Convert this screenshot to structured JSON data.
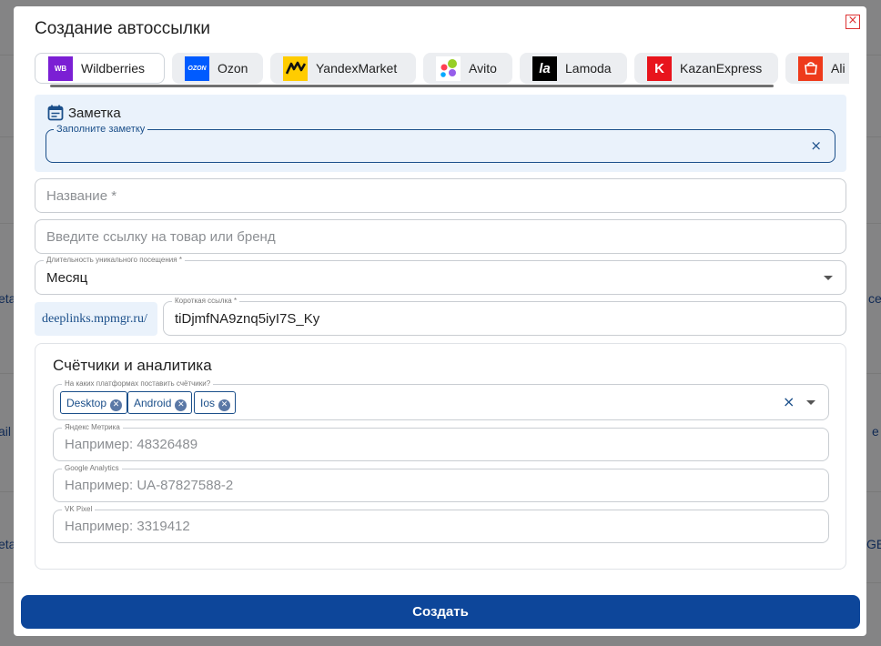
{
  "modal": {
    "title": "Создание автоссылки",
    "close_symbol": "×",
    "tabs": [
      {
        "label": "Wildberries",
        "logo": "WB",
        "logo_bg": "#7b1fd4",
        "active": true
      },
      {
        "label": "Ozon",
        "logo": "OZON",
        "logo_bg": "#005bff",
        "active": false
      },
      {
        "label": "YandexMarket",
        "logo": "YM",
        "logo_bg": "#ffcc00",
        "active": false
      },
      {
        "label": "Avito",
        "logo": "avito-dots",
        "logo_bg": "#ffffff",
        "active": false
      },
      {
        "label": "Lamoda",
        "logo": "la",
        "logo_bg": "#000000",
        "active": false
      },
      {
        "label": "KazanExpress",
        "logo": "K",
        "logo_bg": "#e8141c",
        "active": false
      },
      {
        "label": "Ali",
        "logo": "ali",
        "logo_bg": "#ee3a1b",
        "active": false
      }
    ],
    "note": {
      "title": "Заметка",
      "field_label": "Заполните заметку",
      "value": "",
      "clear_symbol": "×"
    },
    "name_field": {
      "placeholder": "Название *"
    },
    "link_field": {
      "placeholder": "Введите ссылку на товар или бренд"
    },
    "duration_field": {
      "label": "Длительность уникального посещения *",
      "value": "Месяц"
    },
    "short_link": {
      "prefix": "deeplinks.mpmgr.ru/",
      "label": "Короткая ссылка *",
      "value": "tiDjmfNA9znq5iyI7S_Ky"
    },
    "analytics": {
      "title": "Счётчики и аналитика",
      "platforms_label": "На каких платформах поставить счётчики?",
      "platforms": [
        "Desktop",
        "Android",
        "Ios"
      ],
      "clear_symbol": "×",
      "yandex_metrika": {
        "label": "Яндекс Метрика",
        "placeholder": "Например: 48326489"
      },
      "google_analytics": {
        "label": "Google Analytics",
        "placeholder": "Например: UA-87827588-2"
      },
      "vk_pixel": {
        "label": "VK Pixel",
        "placeholder": "Например: 3319412"
      }
    },
    "submit_label": "Создать"
  },
  "background": {
    "fragments": [
      "eta",
      "ail",
      "eta",
      "ce",
      "e",
      "GE"
    ]
  },
  "colors": {
    "primary": "#0d469a",
    "note_bg": "#eaf2fb",
    "close_red": "#dd3333"
  }
}
